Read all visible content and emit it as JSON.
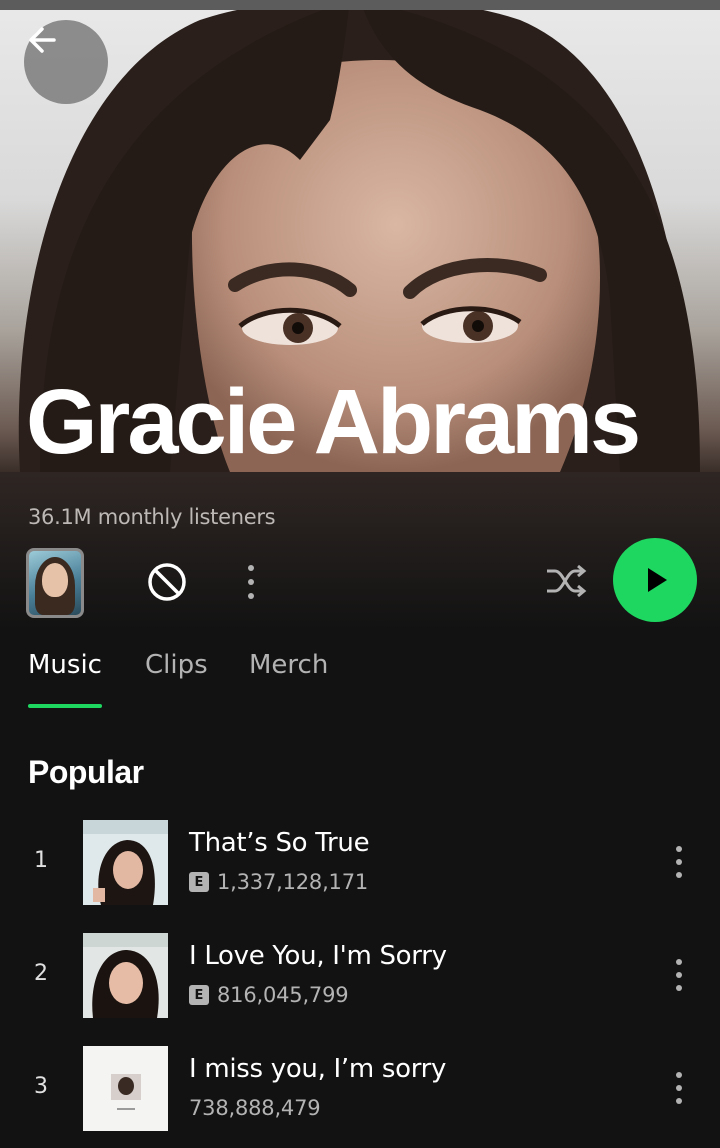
{
  "artist": {
    "name": "Gracie Abrams",
    "monthly_listeners": "36.1M monthly listeners"
  },
  "controls": {
    "back_icon": "arrow-left-icon",
    "block_icon": "block-icon",
    "more_icon": "more-vertical-icon",
    "shuffle_icon": "shuffle-icon",
    "play_icon": "play-icon",
    "accent_color": "#1ed760"
  },
  "tabs": [
    {
      "label": "Music",
      "active": true
    },
    {
      "label": "Clips",
      "active": false
    },
    {
      "label": "Merch",
      "active": false
    }
  ],
  "popular": {
    "title": "Popular",
    "tracks": [
      {
        "rank": "1",
        "title": "That’s So True",
        "explicit": true,
        "explicit_badge": "E",
        "plays": "1,337,128,171"
      },
      {
        "rank": "2",
        "title": "I Love You, I'm Sorry",
        "explicit": true,
        "explicit_badge": "E",
        "plays": "816,045,799"
      },
      {
        "rank": "3",
        "title": "I miss you, I’m sorry",
        "explicit": false,
        "plays": "738,888,479"
      }
    ]
  }
}
